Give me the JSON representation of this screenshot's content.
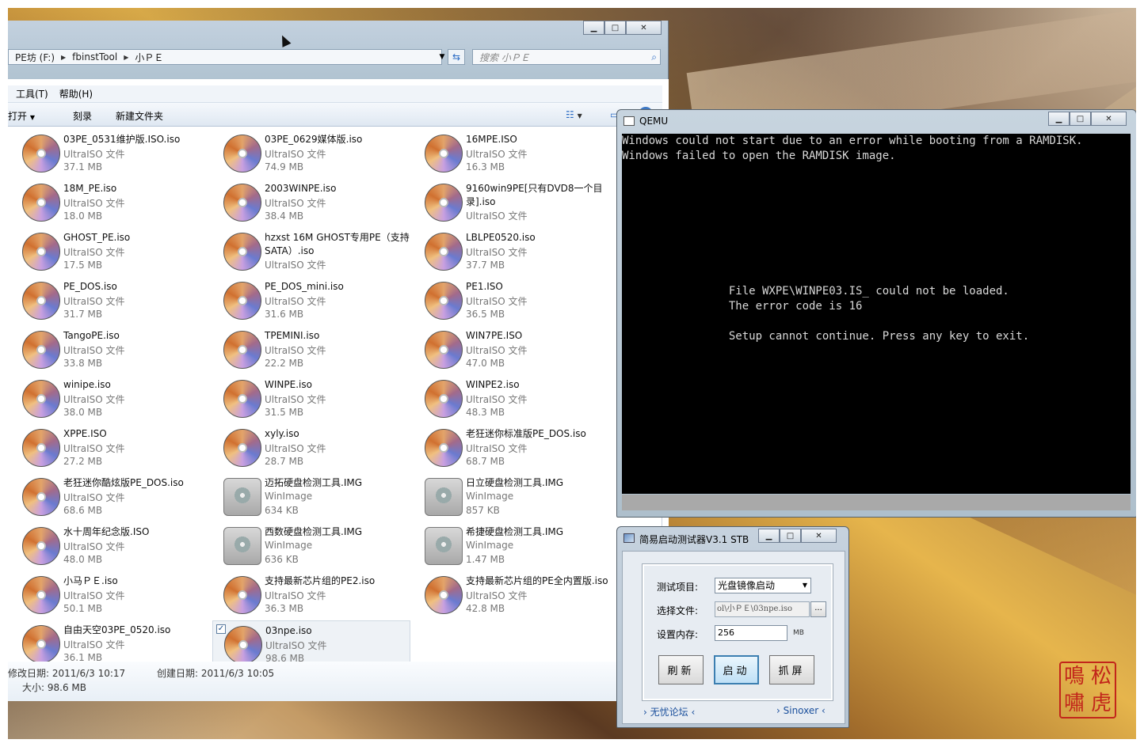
{
  "explorer": {
    "breadcrumb": [
      "PE坊 (F:)",
      "fbinstTool",
      "小ＰＥ"
    ],
    "search_placeholder": "搜索 小ＰＥ",
    "menu": [
      "工具(T)",
      "帮助(H)"
    ],
    "toolbar": {
      "open": "打开",
      "burn": "刻录",
      "new_folder": "新建文件夹"
    },
    "files": [
      {
        "name": "03PE_0531维护版.ISO.iso",
        "type": "UltraISO 文件",
        "size": "37.1 MB",
        "icon": "disc-icon"
      },
      {
        "name": "03PE_0629媒体版.iso",
        "type": "UltraISO 文件",
        "size": "74.9 MB",
        "icon": "disc-icon"
      },
      {
        "name": "16MPE.ISO",
        "type": "UltraISO 文件",
        "size": "16.3 MB",
        "icon": "disc-icon"
      },
      {
        "name": "18M_PE.iso",
        "type": "UltraISO 文件",
        "size": "18.0 MB",
        "icon": "disc-icon"
      },
      {
        "name": "2003WINPE.iso",
        "type": "UltraISO 文件",
        "size": "38.4 MB",
        "icon": "disc-icon"
      },
      {
        "name": "9160win9PE[只有DVD8一个目录].iso",
        "type": "UltraISO 文件",
        "size": "",
        "icon": "disc-icon"
      },
      {
        "name": "GHOST_PE.iso",
        "type": "UltraISO 文件",
        "size": "17.5 MB",
        "icon": "disc-icon"
      },
      {
        "name": "hzxst 16M GHOST专用PE（支持SATA）.iso",
        "type": "UltraISO 文件",
        "size": "",
        "icon": "disc-icon"
      },
      {
        "name": "LBLPE0520.iso",
        "type": "UltraISO 文件",
        "size": "37.7 MB",
        "icon": "disc-icon"
      },
      {
        "name": "PE_DOS.iso",
        "type": "UltraISO 文件",
        "size": "31.7 MB",
        "icon": "disc-icon"
      },
      {
        "name": "PE_DOS_mini.iso",
        "type": "UltraISO 文件",
        "size": "31.6 MB",
        "icon": "disc-icon"
      },
      {
        "name": "PE1.ISO",
        "type": "UltraISO 文件",
        "size": "36.5 MB",
        "icon": "disc-icon"
      },
      {
        "name": "TangoPE.iso",
        "type": "UltraISO 文件",
        "size": "33.8 MB",
        "icon": "disc-icon"
      },
      {
        "name": "TPEMINI.iso",
        "type": "UltraISO 文件",
        "size": "22.2 MB",
        "icon": "disc-icon"
      },
      {
        "name": "WIN7PE.ISO",
        "type": "UltraISO 文件",
        "size": "47.0 MB",
        "icon": "disc-icon"
      },
      {
        "name": "winipe.iso",
        "type": "UltraISO 文件",
        "size": "38.0 MB",
        "icon": "disc-icon"
      },
      {
        "name": "WINPE.iso",
        "type": "UltraISO 文件",
        "size": "31.5 MB",
        "icon": "disc-icon"
      },
      {
        "name": "WINPE2.iso",
        "type": "UltraISO 文件",
        "size": "48.3 MB",
        "icon": "disc-icon"
      },
      {
        "name": "XPPE.ISO",
        "type": "UltraISO 文件",
        "size": "27.2 MB",
        "icon": "disc-icon"
      },
      {
        "name": "xyly.iso",
        "type": "UltraISO 文件",
        "size": "28.7 MB",
        "icon": "disc-icon"
      },
      {
        "name": "老狂迷你标准版PE_DOS.iso",
        "type": "UltraISO 文件",
        "size": "68.7 MB",
        "icon": "disc-icon"
      },
      {
        "name": "老狂迷你酷炫版PE_DOS.iso",
        "type": "UltraISO 文件",
        "size": "68.6 MB",
        "icon": "disc-icon"
      },
      {
        "name": "迈拓硬盘检测工具.IMG",
        "type": "WinImage",
        "size": "634 KB",
        "icon": "floppy-icon"
      },
      {
        "name": "日立硬盘检测工具.IMG",
        "type": "WinImage",
        "size": "857 KB",
        "icon": "floppy-icon"
      },
      {
        "name": "水十周年纪念版.ISO",
        "type": "UltraISO 文件",
        "size": "48.0 MB",
        "icon": "disc-icon"
      },
      {
        "name": "西数硬盘检测工具.IMG",
        "type": "WinImage",
        "size": "636 KB",
        "icon": "floppy-icon"
      },
      {
        "name": "希捷硬盘检测工具.IMG",
        "type": "WinImage",
        "size": "1.47 MB",
        "icon": "floppy-icon"
      },
      {
        "name": "小马ＰＥ.iso",
        "type": "UltraISO 文件",
        "size": "50.1 MB",
        "icon": "disc-icon"
      },
      {
        "name": "支持最新芯片组的PE2.iso",
        "type": "UltraISO 文件",
        "size": "36.3 MB",
        "icon": "disc-icon"
      },
      {
        "name": "支持最新芯片组的PE全内置版.iso",
        "type": "UltraISO 文件",
        "size": "42.8 MB",
        "icon": "disc-icon"
      },
      {
        "name": "自由天空03PE_0520.iso",
        "type": "UltraISO 文件",
        "size": "36.1 MB",
        "icon": "disc-icon"
      },
      {
        "name": "03npe.iso",
        "type": "UltraISO 文件",
        "size": "98.6 MB",
        "icon": "disc-icon",
        "selected": true
      }
    ],
    "details": {
      "modified": "修改日期: 2011/6/3 10:17",
      "created": "创建日期: 2011/6/3 10:05",
      "size": "大小: 98.6 MB"
    }
  },
  "qemu": {
    "title": "QEMU",
    "screen": "Windows could not start due to an error while booting from a RAMDISK.\nWindows failed to open the RAMDISK image.\n\n\n\n\n\n\n\n\n                File WXPE\\WINPE03.IS_ could not be loaded.\n                The error code is 16\n\n                Setup cannot continue. Press any key to exit."
  },
  "tester": {
    "title": "简易启动测试器V3.1 STB",
    "test_item_label": "测试项目:",
    "test_item_value": "光盘镜像启动",
    "file_label": "选择文件:",
    "file_value": "ol\\小ＰＥ\\03npe.iso",
    "browse": "...",
    "memory_label": "设置内存:",
    "memory_value": "256",
    "memory_unit": "MB",
    "btn_refresh": "刷新",
    "btn_start": "启动",
    "btn_capture": "抓屏",
    "link1": "无忧论坛",
    "link2": "Sinoxer"
  },
  "seal": [
    "松",
    "虎",
    "鳴",
    "嘯"
  ]
}
